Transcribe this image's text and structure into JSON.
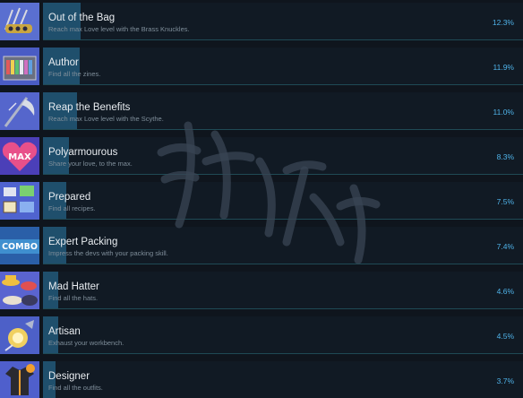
{
  "achievements": [
    {
      "title": "Out of the Bag",
      "desc": "Reach max Love level with the Brass Knuckles.",
      "pct": "12.3%",
      "value": 12.3,
      "icon": "brass-knuckles-icon",
      "bg": "#5a6fd0"
    },
    {
      "title": "Author",
      "desc": "Find all the zines.",
      "pct": "11.9%",
      "value": 11.9,
      "icon": "zine-shelf-icon",
      "bg": "#4a5cc4"
    },
    {
      "title": "Reap the Benefits",
      "desc": "Reach max Love level with the Scythe.",
      "pct": "11.0%",
      "value": 11.0,
      "icon": "scythe-icon",
      "bg": "#5566cc"
    },
    {
      "title": "Polyarmourous",
      "desc": "Share your love, to the max.",
      "pct": "8.3%",
      "value": 8.3,
      "icon": "max-heart-icon",
      "bg": "#4b3fb8"
    },
    {
      "title": "Prepared",
      "desc": "Find all recipes.",
      "pct": "7.5%",
      "value": 7.5,
      "icon": "recipe-cards-icon",
      "bg": "#4f63cf"
    },
    {
      "title": "Expert Packing",
      "desc": "Impress the devs with your packing skill.",
      "pct": "7.4%",
      "value": 7.4,
      "icon": "combo-icon",
      "bg": "#3f8fcf"
    },
    {
      "title": "Mad Hatter",
      "desc": "Find all the hats.",
      "pct": "4.6%",
      "value": 4.6,
      "icon": "hats-icon",
      "bg": "#5a64d0"
    },
    {
      "title": "Artisan",
      "desc": "Exhaust your workbench.",
      "pct": "4.5%",
      "value": 4.5,
      "icon": "workbench-icon",
      "bg": "#4d60c8"
    },
    {
      "title": "Designer",
      "desc": "Find all the outfits.",
      "pct": "3.7%",
      "value": 3.7,
      "icon": "outfit-icon",
      "bg": "#4f5fcc"
    }
  ]
}
